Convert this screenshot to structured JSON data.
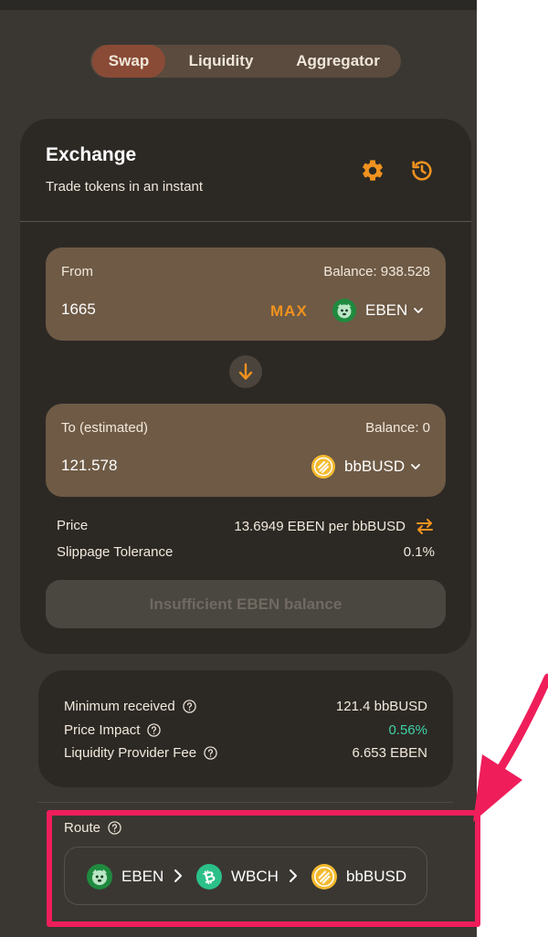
{
  "tabs": [
    {
      "label": "Swap",
      "active": true
    },
    {
      "label": "Liquidity",
      "active": false
    },
    {
      "label": "Aggregator",
      "active": false
    }
  ],
  "exchange": {
    "title": "Exchange",
    "subtitle": "Trade tokens in an instant",
    "settings_icon": "gear-icon",
    "history_icon": "history-icon"
  },
  "from": {
    "label": "From",
    "balance": "Balance: 938.528",
    "amount": "1665",
    "max_label": "MAX",
    "token": "EBEN"
  },
  "to": {
    "label": "To (estimated)",
    "balance": "Balance: 0",
    "amount": "121.578",
    "token": "bbBUSD"
  },
  "price": {
    "label": "Price",
    "value": "13.6949 EBEN per bbBUSD"
  },
  "slippage": {
    "label": "Slippage Tolerance",
    "value": "0.1%"
  },
  "action_button": "Insufficient EBEN balance",
  "summary": {
    "min_received": {
      "label": "Minimum received",
      "value": "121.4 bbBUSD"
    },
    "price_impact": {
      "label": "Price Impact",
      "value": "0.56%"
    },
    "lp_fee": {
      "label": "Liquidity Provider Fee",
      "value": "6.653 EBEN"
    }
  },
  "route": {
    "label": "Route",
    "tokens": [
      "EBEN",
      "WBCH",
      "bbBUSD"
    ]
  },
  "colors": {
    "background": "#3a3732",
    "card": "#2c2925",
    "accent_orange": "#f0921f",
    "active_tab": "#8a4b36",
    "impact_green": "#3fd1a6",
    "annotation": "#ef1e5b"
  }
}
